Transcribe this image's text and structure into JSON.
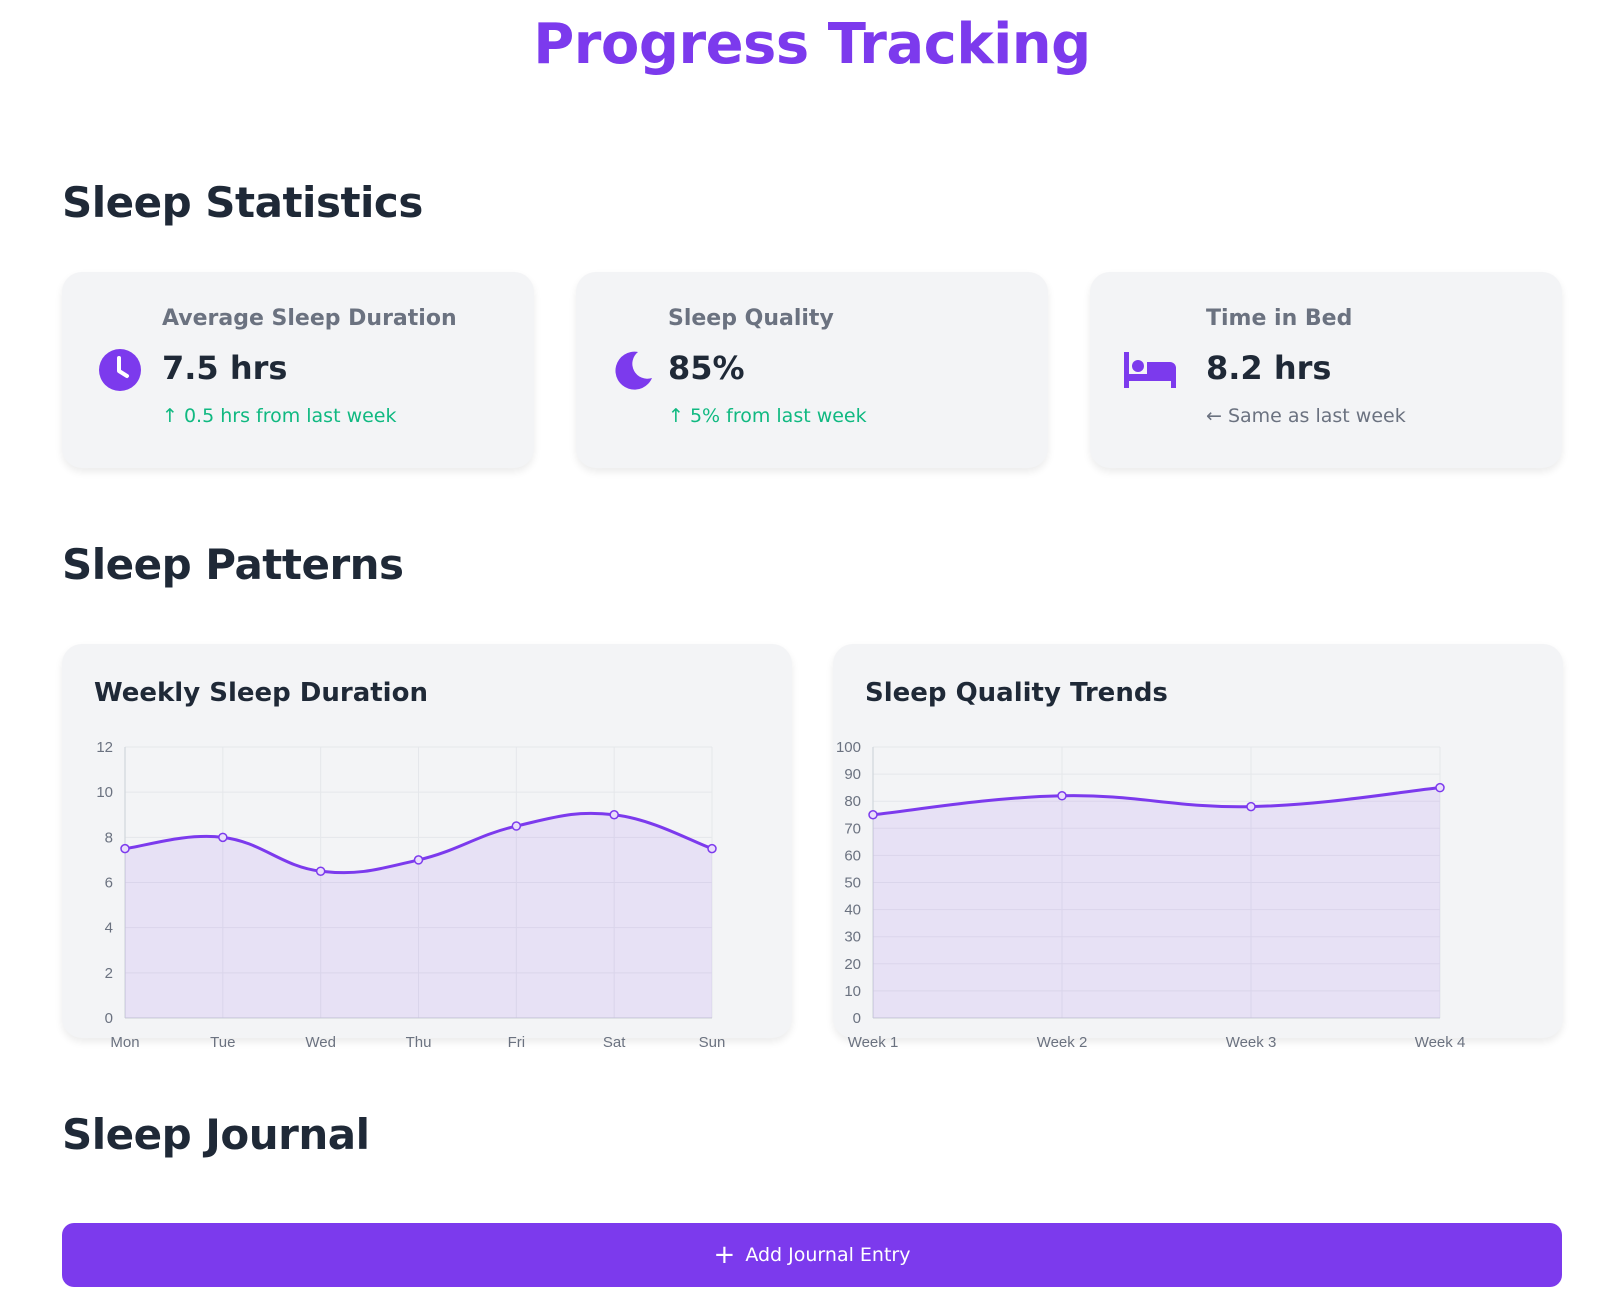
{
  "page": {
    "title": "Progress Tracking"
  },
  "sections": {
    "statistics": "Sleep Statistics",
    "patterns": "Sleep Patterns",
    "journal": "Sleep Journal"
  },
  "stats": [
    {
      "label": "Average Sleep Duration",
      "value": "7.5 hrs",
      "change": "↑ 0.5 hrs from last week",
      "trend": "up",
      "icon": "clock-icon"
    },
    {
      "label": "Sleep Quality",
      "value": "85%",
      "change": "↑ 5% from last week",
      "trend": "up",
      "icon": "moon-icon"
    },
    {
      "label": "Time in Bed",
      "value": "8.2 hrs",
      "change": "← Same as last week",
      "trend": "neutral",
      "icon": "bed-icon"
    }
  ],
  "colors": {
    "accent": "#7c3aed",
    "positive": "#10b981",
    "neutral": "#6b7280",
    "card_bg": "#f3f4f6"
  },
  "chart_data": [
    {
      "type": "area",
      "title": "Weekly Sleep Duration",
      "categories": [
        "Mon",
        "Tue",
        "Wed",
        "Thu",
        "Fri",
        "Sat",
        "Sun"
      ],
      "values": [
        7.5,
        8,
        6.5,
        7,
        8.5,
        9,
        7.5
      ],
      "ylim": [
        0,
        12
      ],
      "yticks": [
        0,
        2,
        4,
        6,
        8,
        10,
        12
      ],
      "grid": true,
      "legend": "none"
    },
    {
      "type": "area",
      "title": "Sleep Quality Trends",
      "categories": [
        "Week 1",
        "Week 2",
        "Week 3",
        "Week 4"
      ],
      "values": [
        75,
        82,
        78,
        85
      ],
      "ylim": [
        0,
        100
      ],
      "yticks": [
        0,
        10,
        20,
        30,
        40,
        50,
        60,
        70,
        80,
        90,
        100
      ],
      "grid": true,
      "legend": "none"
    }
  ],
  "journal": {
    "add_label": "Add Journal Entry",
    "add_icon": "plus-icon"
  }
}
